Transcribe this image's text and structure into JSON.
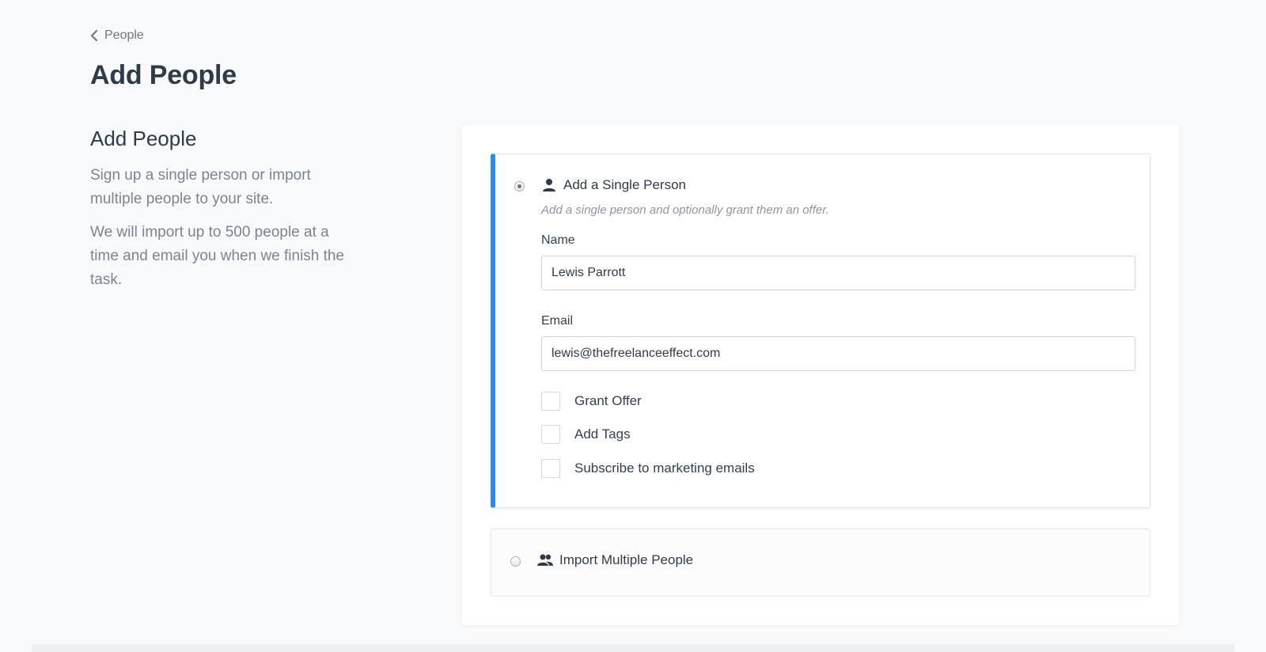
{
  "breadcrumb": {
    "label": "People"
  },
  "page": {
    "title": "Add People"
  },
  "sidebar": {
    "heading": "Add People",
    "paragraph1": "Sign up a single person or import multiple people to your site.",
    "paragraph2": "We will import up to 500 people at a time and email you when we finish the task."
  },
  "single_option": {
    "title": "Add a Single Person",
    "icon": "person-icon",
    "description": "Add a single person and optionally grant them an offer.",
    "selected": true,
    "name_label": "Name",
    "name_value": "Lewis Parrott",
    "email_label": "Email",
    "email_value": "lewis@thefreelanceeffect.com",
    "checkboxes": [
      {
        "label": "Grant Offer",
        "checked": false
      },
      {
        "label": "Add Tags",
        "checked": false
      },
      {
        "label": "Subscribe to marketing emails",
        "checked": false
      }
    ]
  },
  "multi_option": {
    "title": "Import Multiple People",
    "icon": "people-icon",
    "selected": false
  },
  "colors": {
    "accent": "#2f8bea",
    "background": "#f8f9fb",
    "text": "#2f3b49",
    "muted": "#7a8593"
  }
}
